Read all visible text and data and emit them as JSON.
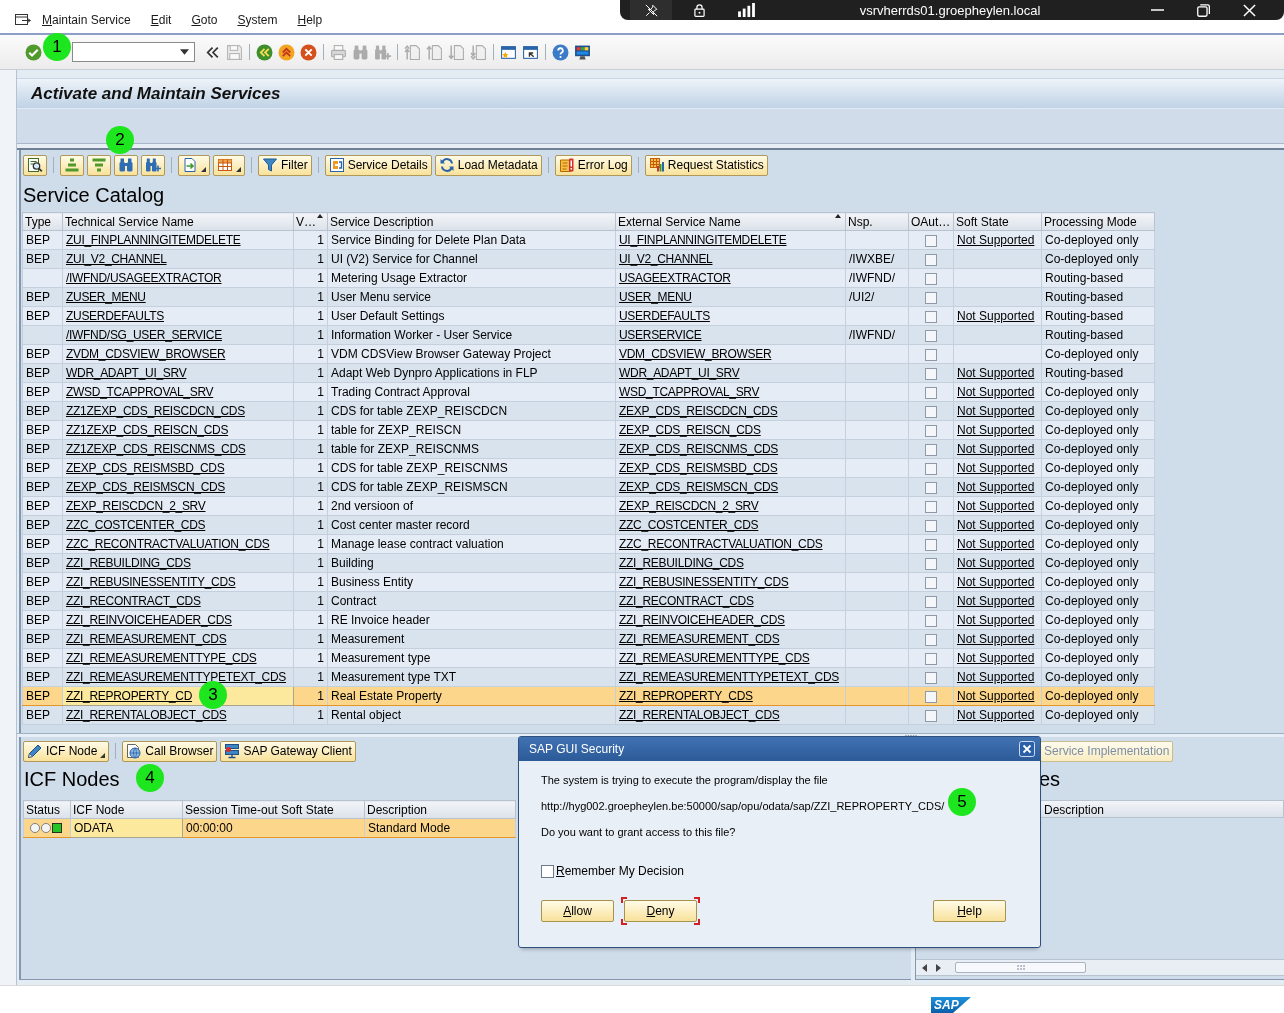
{
  "connection_bar": {
    "title": "vsrvherrds01.groepheylen.local"
  },
  "menu": [
    "Maintain Service",
    "Edit",
    "Goto",
    "System",
    "Help"
  ],
  "system_toolbar": {
    "enter": {
      "disabled": false
    },
    "groups": [
      {
        "buttons": [
          {
            "disabled": false
          },
          {
            "disabled": true
          }
        ]
      },
      {
        "buttons": [
          {
            "disabled": false
          },
          {
            "disabled": false
          },
          {
            "disabled": false
          }
        ]
      },
      {
        "buttons": [
          {
            "disabled": true
          },
          {
            "disabled": true
          },
          {
            "disabled": true
          }
        ]
      },
      {
        "buttons": [
          {
            "disabled": true
          },
          {
            "disabled": true
          },
          {
            "disabled": true
          },
          {
            "disabled": true
          }
        ]
      },
      {
        "buttons": [
          {
            "disabled": false
          },
          {
            "disabled": false
          }
        ]
      },
      {
        "buttons": [
          {
            "disabled": false
          },
          {
            "disabled": false
          }
        ]
      }
    ]
  },
  "title": "Activate and Maintain Services",
  "service_catalog": {
    "toolbar": [
      {
        "buttons": [
          {
            "menu": false
          }
        ]
      },
      {
        "buttons": [
          {
            "menu": false
          },
          {
            "menu": false
          },
          {
            "menu": false
          },
          {
            "menu": false
          }
        ]
      },
      {
        "buttons": [
          {
            "menu": true
          },
          {
            "menu": true
          }
        ]
      },
      {
        "buttons": [
          {
            "label": "Filter",
            "menu": false
          }
        ]
      },
      {
        "buttons": [
          {
            "label": "Service Details",
            "menu": false
          },
          {
            "label": "Load Metadata",
            "menu": false
          }
        ]
      },
      {
        "buttons": [
          {
            "label": "Error Log",
            "menu": false
          }
        ]
      },
      {
        "buttons": [
          {
            "label": "Request Statistics",
            "menu": false
          }
        ]
      }
    ],
    "heading": "Service Catalog",
    "columns": [
      {
        "label": "Type",
        "sorted": false
      },
      {
        "label": "Technical Service Name",
        "sorted": false
      },
      {
        "label": "V…",
        "sorted": true
      },
      {
        "label": "Service Description",
        "sorted": false
      },
      {
        "label": "External Service Name",
        "sorted": true
      },
      {
        "label": "Nsp.",
        "sorted": false
      },
      {
        "label": "OAut…",
        "sorted": false
      },
      {
        "label": "Soft State",
        "sorted": false
      },
      {
        "label": "Processing Mode",
        "sorted": false
      }
    ],
    "rows": [
      {
        "type": "BEP",
        "technical_name": "ZUI_FINPLANNINGITEMDELETE",
        "version": "1",
        "description": "Service Binding for Delete Plan Data",
        "external_name": "UI_FINPLANNINGITEMDELETE",
        "oauth": false,
        "soft_state": "Not Supported",
        "processing_mode": "Co-deployed only",
        "selected": false,
        "focused": false
      },
      {
        "type": "BEP",
        "technical_name": "ZUI_V2_CHANNEL",
        "version": "1",
        "description": "UI (V2) Service for Channel",
        "external_name": "UI_V2_CHANNEL",
        "namespace": "/IWXBE/",
        "oauth": false,
        "processing_mode": "Co-deployed only",
        "selected": false,
        "focused": false
      },
      {
        "technical_name": "/IWFND/USAGEEXTRACTOR",
        "version": "1",
        "description": "Metering Usage Extractor",
        "external_name": "USAGEEXTRACTOR",
        "namespace": "/IWFND/",
        "oauth": false,
        "processing_mode": "Routing-based",
        "selected": false,
        "focused": false
      },
      {
        "type": "BEP",
        "technical_name": "ZUSER_MENU",
        "version": "1",
        "description": "User Menu service",
        "external_name": "USER_MENU",
        "namespace": "/UI2/",
        "oauth": false,
        "processing_mode": "Routing-based",
        "selected": false,
        "focused": false
      },
      {
        "type": "BEP",
        "technical_name": "ZUSERDEFAULTS",
        "version": "1",
        "description": "User Default Settings",
        "external_name": "USERDEFAULTS",
        "oauth": false,
        "soft_state": "Not Supported",
        "processing_mode": "Routing-based",
        "selected": false,
        "focused": false
      },
      {
        "technical_name": "/IWFND/SG_USER_SERVICE",
        "version": "1",
        "description": "Information Worker - User Service",
        "external_name": "USERSERVICE",
        "namespace": "/IWFND/",
        "oauth": false,
        "processing_mode": "Routing-based",
        "selected": false,
        "focused": false
      },
      {
        "type": "BEP",
        "technical_name": "ZVDM_CDSVIEW_BROWSER",
        "version": "1",
        "description": "VDM CDSView Browser Gateway Project",
        "external_name": "VDM_CDSVIEW_BROWSER",
        "oauth": false,
        "processing_mode": "Co-deployed only",
        "selected": false,
        "focused": false
      },
      {
        "type": "BEP",
        "technical_name": "WDR_ADAPT_UI_SRV",
        "version": "1",
        "description": "Adapt Web Dynpro Applications in FLP",
        "external_name": "WDR_ADAPT_UI_SRV",
        "oauth": false,
        "soft_state": "Not Supported",
        "processing_mode": "Routing-based",
        "selected": false,
        "focused": false
      },
      {
        "type": "BEP",
        "technical_name": "ZWSD_TCAPPROVAL_SRV",
        "version": "1",
        "description": "Trading Contract Approval",
        "external_name": "WSD_TCAPPROVAL_SRV",
        "oauth": false,
        "soft_state": "Not Supported",
        "processing_mode": "Co-deployed only",
        "selected": false,
        "focused": false
      },
      {
        "type": "BEP",
        "technical_name": "ZZ1ZEXP_CDS_REISCDCN_CDS",
        "version": "1",
        "description": "CDS for table ZEXP_REISCDCN",
        "external_name": "ZEXP_CDS_REISCDCN_CDS",
        "oauth": false,
        "soft_state": "Not Supported",
        "processing_mode": "Co-deployed only",
        "selected": false,
        "focused": false
      },
      {
        "type": "BEP",
        "technical_name": "ZZ1ZEXP_CDS_REISCN_CDS",
        "version": "1",
        "description": "table for ZEXP_REISCN",
        "external_name": "ZEXP_CDS_REISCN_CDS",
        "oauth": false,
        "soft_state": "Not Supported",
        "processing_mode": "Co-deployed only",
        "selected": false,
        "focused": false
      },
      {
        "type": "BEP",
        "technical_name": "ZZ1ZEXP_CDS_REISCNMS_CDS",
        "version": "1",
        "description": "table for ZEXP_REISCNMS",
        "external_name": "ZEXP_CDS_REISCNMS_CDS",
        "oauth": false,
        "soft_state": "Not Supported",
        "processing_mode": "Co-deployed only",
        "selected": false,
        "focused": false
      },
      {
        "type": "BEP",
        "technical_name": "ZEXP_CDS_REISMSBD_CDS",
        "version": "1",
        "description": "CDS for table ZEXP_REISCNMS",
        "external_name": "ZEXP_CDS_REISMSBD_CDS",
        "oauth": false,
        "soft_state": "Not Supported",
        "processing_mode": "Co-deployed only",
        "selected": false,
        "focused": false
      },
      {
        "type": "BEP",
        "technical_name": "ZEXP_CDS_REISMSCN_CDS",
        "version": "1",
        "description": "CDS for table ZEXP_REISMSCN",
        "external_name": "ZEXP_CDS_REISMSCN_CDS",
        "oauth": false,
        "soft_state": "Not Supported",
        "processing_mode": "Co-deployed only",
        "selected": false,
        "focused": false
      },
      {
        "type": "BEP",
        "technical_name": "ZEXP_REISCDCN_2_SRV",
        "version": "1",
        "description": "2nd versioon of",
        "external_name": "ZEXP_REISCDCN_2_SRV",
        "oauth": false,
        "soft_state": "Not Supported",
        "processing_mode": "Co-deployed only",
        "selected": false,
        "focused": false
      },
      {
        "type": "BEP",
        "technical_name": "ZZC_COSTCENTER_CDS",
        "version": "1",
        "description": "Cost center master record",
        "external_name": "ZZC_COSTCENTER_CDS",
        "oauth": false,
        "soft_state": "Not Supported",
        "processing_mode": "Co-deployed only",
        "selected": false,
        "focused": false
      },
      {
        "type": "BEP",
        "technical_name": "ZZC_RECONTRACTVALUATION_CDS",
        "version": "1",
        "description": "Manage lease contract valuation",
        "external_name": "ZZC_RECONTRACTVALUATION_CDS",
        "oauth": false,
        "soft_state": "Not Supported",
        "processing_mode": "Co-deployed only",
        "selected": false,
        "focused": false
      },
      {
        "type": "BEP",
        "technical_name": "ZZI_REBUILDING_CDS",
        "version": "1",
        "description": "Building",
        "external_name": "ZZI_REBUILDING_CDS",
        "oauth": false,
        "soft_state": "Not Supported",
        "processing_mode": "Co-deployed only",
        "selected": false,
        "focused": false
      },
      {
        "type": "BEP",
        "technical_name": "ZZI_REBUSINESSENTITY_CDS",
        "version": "1",
        "description": "Business Entity",
        "external_name": "ZZI_REBUSINESSENTITY_CDS",
        "oauth": false,
        "soft_state": "Not Supported",
        "processing_mode": "Co-deployed only",
        "selected": false,
        "focused": false
      },
      {
        "type": "BEP",
        "technical_name": "ZZI_RECONTRACT_CDS",
        "version": "1",
        "description": "Contract",
        "external_name": "ZZI_RECONTRACT_CDS",
        "oauth": false,
        "soft_state": "Not Supported",
        "processing_mode": "Co-deployed only",
        "selected": false,
        "focused": false
      },
      {
        "type": "BEP",
        "technical_name": "ZZI_REINVOICEHEADER_CDS",
        "version": "1",
        "description": "RE Invoice header",
        "external_name": "ZZI_REINVOICEHEADER_CDS",
        "oauth": false,
        "soft_state": "Not Supported",
        "processing_mode": "Co-deployed only",
        "selected": false,
        "focused": false
      },
      {
        "type": "BEP",
        "technical_name": "ZZI_REMEASUREMENT_CDS",
        "version": "1",
        "description": "Measurement",
        "external_name": "ZZI_REMEASUREMENT_CDS",
        "oauth": false,
        "soft_state": "Not Supported",
        "processing_mode": "Co-deployed only",
        "selected": false,
        "focused": false
      },
      {
        "type": "BEP",
        "technical_name": "ZZI_REMEASUREMENTTYPE_CDS",
        "version": "1",
        "description": "Measurement type",
        "external_name": "ZZI_REMEASUREMENTTYPE_CDS",
        "oauth": false,
        "soft_state": "Not Supported",
        "processing_mode": "Co-deployed only",
        "selected": false,
        "focused": false
      },
      {
        "type": "BEP",
        "technical_name": "ZZI_REMEASUREMENTTYPETEXT_CDS",
        "version": "1",
        "description": "Measurement type TXT",
        "external_name": "ZZI_REMEASUREMENTTYPETEXT_CDS",
        "oauth": false,
        "soft_state": "Not Supported",
        "processing_mode": "Co-deployed only",
        "selected": false,
        "focused": false
      },
      {
        "type": "BEP",
        "technical_name": "ZZI_REPROPERTY_CD",
        "version": "1",
        "description": "Real Estate Property",
        "external_name": "ZZI_REPROPERTY_CDS",
        "oauth": false,
        "soft_state": "Not Supported",
        "processing_mode": "Co-deployed only",
        "selected": true,
        "focused": true
      },
      {
        "type": "BEP",
        "technical_name": "ZZI_RERENTALOBJECT_CDS",
        "version": "1",
        "description": "Rental object",
        "external_name": "ZZI_RERENTALOBJECT_CDS",
        "oauth": false,
        "soft_state": "Not Supported",
        "processing_mode": "Co-deployed only",
        "selected": false,
        "focused": false
      }
    ]
  },
  "icf_nodes": {
    "toolbar": [
      {
        "buttons": [
          {
            "label": "ICF Node",
            "menu": true
          }
        ]
      },
      {
        "buttons": [
          {
            "label": "Call Browser",
            "menu": false
          },
          {
            "label": "SAP Gateway Client",
            "menu": false
          }
        ]
      }
    ],
    "heading": "ICF Nodes",
    "columns": [
      "Status",
      "ICF Node",
      "Session Time-out Soft State",
      "Description"
    ],
    "rows": [
      {
        "lights": [
          {
            "on": false
          },
          {
            "on": false
          },
          {
            "on": true
          }
        ],
        "icf_node": "ODATA",
        "session_timeout": "00:00:00",
        "description": "Standard Mode",
        "selected": true,
        "focused": true
      }
    ]
  },
  "right_panel": {
    "button": {
      "label": "Service Implementation",
      "disabled": true
    },
    "heading": "es",
    "columns": [
      "Description"
    ]
  },
  "dialog": {
    "title": "SAP GUI Security",
    "lines": [
      "The system is trying to execute the program/display the file",
      "http://hyg002.groepheylen.be:50000/sap/opu/odata/sap/ZZI_REPROPERTY_CDS/",
      "Do you want to grant access to this file?"
    ],
    "remember": {
      "label": "Remember My Decision",
      "checked": false
    },
    "buttons": [
      {
        "label": "Allow",
        "focused": false
      },
      {
        "label": "Deny",
        "focused": true
      },
      {
        "label": "Help",
        "focused": false
      }
    ]
  },
  "status_bar": {
    "logo": "SAP"
  },
  "callouts": [
    {
      "label": "1"
    },
    {
      "label": "2"
    },
    {
      "label": "3"
    },
    {
      "label": "4"
    },
    {
      "label": "5"
    }
  ]
}
